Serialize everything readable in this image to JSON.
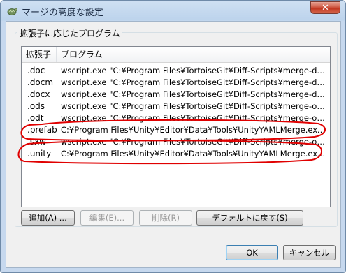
{
  "window": {
    "title": "マージの高度な設定",
    "close_glyph": "✕"
  },
  "group": {
    "label": "拡張子に応じたプログラム"
  },
  "list": {
    "columns": [
      "拡張子",
      "プログラム"
    ],
    "rows": [
      {
        "ext": ".doc",
        "program": "wscript.exe \"C:¥Program Files¥TortoiseGit¥Diff-Scripts¥merge-doc.js\" %mer..."
      },
      {
        "ext": ".docm",
        "program": "wscript.exe \"C:¥Program Files¥TortoiseGit¥Diff-Scripts¥merge-doc.js\" %mer..."
      },
      {
        "ext": ".docx",
        "program": "wscript.exe \"C:¥Program Files¥TortoiseGit¥Diff-Scripts¥merge-doc.js\" %mer..."
      },
      {
        "ext": ".ods",
        "program": "wscript.exe \"C:¥Program Files¥TortoiseGit¥Diff-Scripts¥merge-ods.vbs\" %..."
      },
      {
        "ext": ".odt",
        "program": "wscript.exe \"C:¥Program Files¥TortoiseGit¥Diff-Scripts¥merge-ods.vbs\" %..."
      },
      {
        "ext": ".prefab",
        "program": "C:¥Program Files¥Unity¥Editor¥Data¥Tools¥UnityYAMLMerge.exe merge -..."
      },
      {
        "ext": ".sxw",
        "program": "wscript.exe \"C:¥Program Files¥TortoiseGit¥Diff-Scripts¥merge-ods.vbs\" %..."
      },
      {
        "ext": ".unity",
        "program": "C:¥Program Files¥Unity¥Editor¥Data¥Tools¥UnityYAMLMerge.exe  merge ..."
      }
    ]
  },
  "buttons": {
    "add": "追加(A) ...",
    "edit": "編集(E)...",
    "delete": "削除(R)",
    "restore_default": "デフォルトに戻す(S)",
    "ok": "OK",
    "cancel": "キャンセル"
  },
  "colors": {
    "annotation_red": "#e00000",
    "title_bar": "#bcd3ec",
    "close_red": "#c0351f"
  }
}
